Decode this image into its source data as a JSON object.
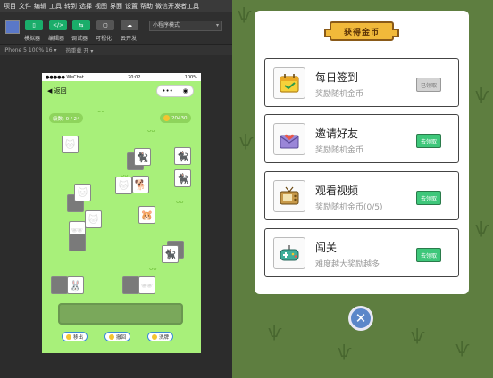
{
  "ide": {
    "menu": [
      "项目",
      "文件",
      "编辑",
      "工具",
      "转到",
      "选择",
      "视图",
      "界面",
      "设置",
      "帮助",
      "微信开发者工具"
    ],
    "toolbar": {
      "simulator": "模拟器",
      "editor": "编辑器",
      "debugger": "调试器",
      "visual": "可视化",
      "cloud": "云开发",
      "mode_select": "小程序模式"
    },
    "subbar": {
      "device": "iPhone 5 100% 16 ▾",
      "hot_reload": "热重载 开 ▾"
    },
    "phone": {
      "status_left": "●●●●● WeChat",
      "status_time": "20:02",
      "status_right": "100%",
      "back_label": "返回",
      "level_label": "级数: 0 / 24",
      "coins": "20430",
      "tools": [
        "移出",
        "撤回",
        "洗牌"
      ]
    }
  },
  "modal": {
    "title": "获得金币",
    "cards": [
      {
        "title": "每日签到",
        "sub": "奖励随机金币",
        "button": "已领取",
        "enabled": false,
        "icon": "checkin-icon"
      },
      {
        "title": "邀请好友",
        "sub": "奖励随机金币",
        "button": "去领取",
        "enabled": true,
        "icon": "invite-icon"
      },
      {
        "title": "观看视频",
        "sub": "奖励随机金币(0/5)",
        "button": "去领取",
        "enabled": true,
        "icon": "tv-icon"
      },
      {
        "title": "闯关",
        "sub": "难度越大奖励越多",
        "button": "去领取",
        "enabled": true,
        "icon": "gamepad-icon"
      }
    ]
  },
  "colors": {
    "accent": "#3ec77a",
    "phone_bg": "#a8f07a",
    "preview_bg": "#5e7e40",
    "plaque": "#f1b93a"
  }
}
